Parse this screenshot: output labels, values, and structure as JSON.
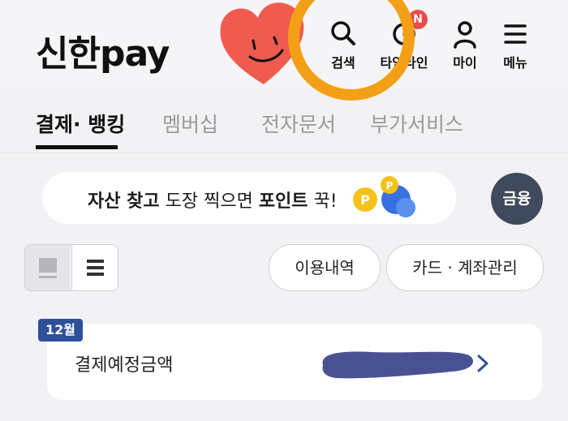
{
  "header": {
    "logo": "신한pay",
    "nav": [
      {
        "label": "검색",
        "icon": "search-icon"
      },
      {
        "label": "타임라인",
        "icon": "timeline-icon",
        "badge": "N"
      },
      {
        "label": "마이",
        "icon": "person-icon"
      },
      {
        "label": "메뉴",
        "icon": "menu-icon"
      }
    ]
  },
  "tabs": [
    "결제· 뱅킹",
    "멤버십",
    "전자문서",
    "부가서비스"
  ],
  "banner": {
    "part1": "자산 찾고",
    "part2": " 도장 찍으면 ",
    "part3": "포인트",
    "part4": " 꾹!"
  },
  "finance_button": "금융",
  "pills": [
    "이용내역",
    "카드 · 계좌관리"
  ],
  "card": {
    "month": "12월",
    "label": "결제예정금액"
  },
  "colors": {
    "accent_orange": "#f4a017",
    "heart": "#f05a4f",
    "tag_blue": "#2f4f99",
    "finance_button": "#3f4a5c",
    "redaction": "#4a5193"
  }
}
